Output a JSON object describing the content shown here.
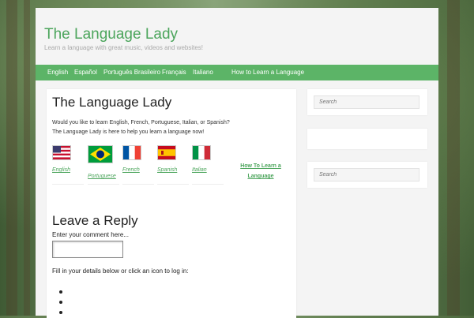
{
  "site": {
    "title": "The Language Lady",
    "tagline": "Learn a language with great music, videos and websites!"
  },
  "nav": {
    "items": [
      {
        "label": "English"
      },
      {
        "label": "Español"
      },
      {
        "label": "Português Brasileiro"
      },
      {
        "label": "Français"
      },
      {
        "label": "Italiano"
      },
      {
        "label": "How to Learn a Language"
      }
    ]
  },
  "main": {
    "title": "The Language Lady",
    "intro_line1": "Would you like to learn English, French, Portuguese, Italian, or Spanish?",
    "intro_line2": "The Language Lady is here to help you learn a language now!",
    "languages": [
      {
        "label": "English",
        "flag": "us-flag-icon"
      },
      {
        "label": "Portuguese",
        "flag": "brazil-flag-icon"
      },
      {
        "label": "French",
        "flag": "france-flag-icon"
      },
      {
        "label": "Spanish",
        "flag": "spain-flag-icon"
      },
      {
        "label": "Italian",
        "flag": "italy-flag-icon"
      }
    ],
    "howto_link": "How To Learn a Language"
  },
  "reply": {
    "title": "Leave a Reply",
    "comment_label": "Enter your comment here...",
    "fill_text": "Fill in your details below or click an icon to log in:"
  },
  "sidebar": {
    "search_placeholder_1": "Search",
    "search_placeholder_2": "Search"
  },
  "colors": {
    "accent": "#5cb467",
    "link": "#4ca55c"
  }
}
